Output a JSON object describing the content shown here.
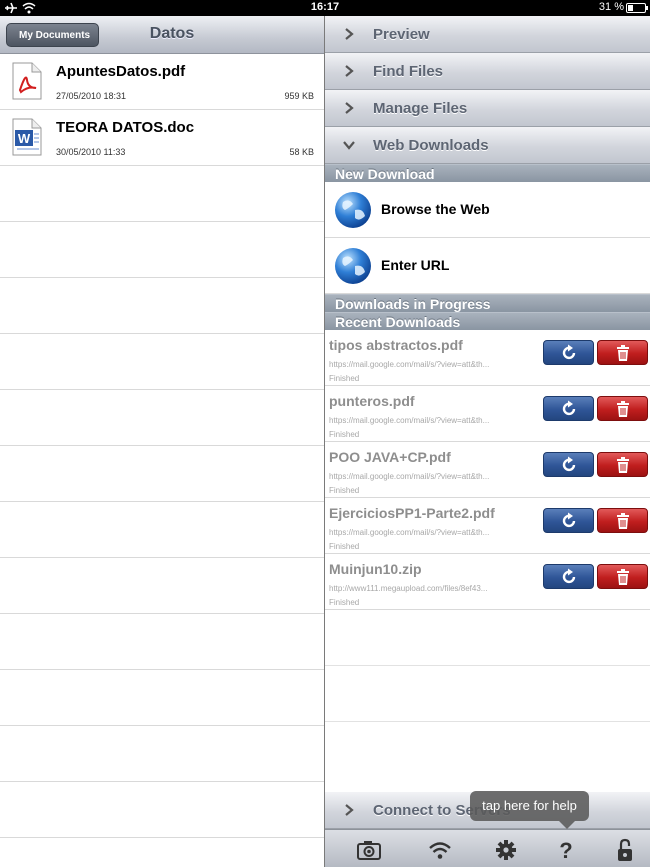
{
  "status_bar": {
    "time": "16:17",
    "battery": "31 %",
    "battery_level": 0.31
  },
  "left": {
    "back_button": "My Documents",
    "title": "Datos",
    "files": [
      {
        "name": "ApuntesDatos.pdf",
        "date": "27/05/2010 18:31",
        "size": "959 KB",
        "icon": "pdf-icon"
      },
      {
        "name": "TEORA DATOS.doc",
        "date": "30/05/2010 11:33",
        "size": "58 KB",
        "icon": "word-doc-icon"
      }
    ]
  },
  "right": {
    "accordion": [
      {
        "label": "Preview",
        "expanded": false
      },
      {
        "label": "Find Files",
        "expanded": false
      },
      {
        "label": "Manage Files",
        "expanded": false
      },
      {
        "label": "Web Downloads",
        "expanded": true
      }
    ],
    "new_download_header": "New Download",
    "actions": [
      {
        "label": "Browse the Web",
        "icon": "globe-icon"
      },
      {
        "label": "Enter URL",
        "icon": "globe-icon"
      }
    ],
    "in_progress_header": "Downloads in Progress",
    "recent_header": "Recent Downloads",
    "downloads": [
      {
        "name": "tipos abstractos.pdf",
        "url": "https://mail.google.com/mail/s/?view=att&th...",
        "status": "Finished"
      },
      {
        "name": "punteros.pdf",
        "url": "https://mail.google.com/mail/s/?view=att&th...",
        "status": "Finished"
      },
      {
        "name": "POO JAVA+CP.pdf",
        "url": "https://mail.google.com/mail/s/?view=att&th...",
        "status": "Finished"
      },
      {
        "name": "EjerciciosPP1-Parte2.pdf",
        "url": "https://mail.google.com/mail/s/?view=att&th...",
        "status": "Finished"
      },
      {
        "name": "Muinjun10.zip",
        "url": "http://www111.megaupload.com/files/8ef43...",
        "status": "Finished"
      }
    ],
    "connect_label": "Connect to Servers",
    "toolbar": [
      "camera-icon",
      "wifi-icon",
      "gear-icon",
      "help-icon",
      "lock-icon"
    ],
    "tooltip": "tap here for help"
  },
  "colors": {
    "refresh_button": "#2f5597",
    "delete_button": "#c01e1e",
    "section_header": "#8a95a2"
  }
}
